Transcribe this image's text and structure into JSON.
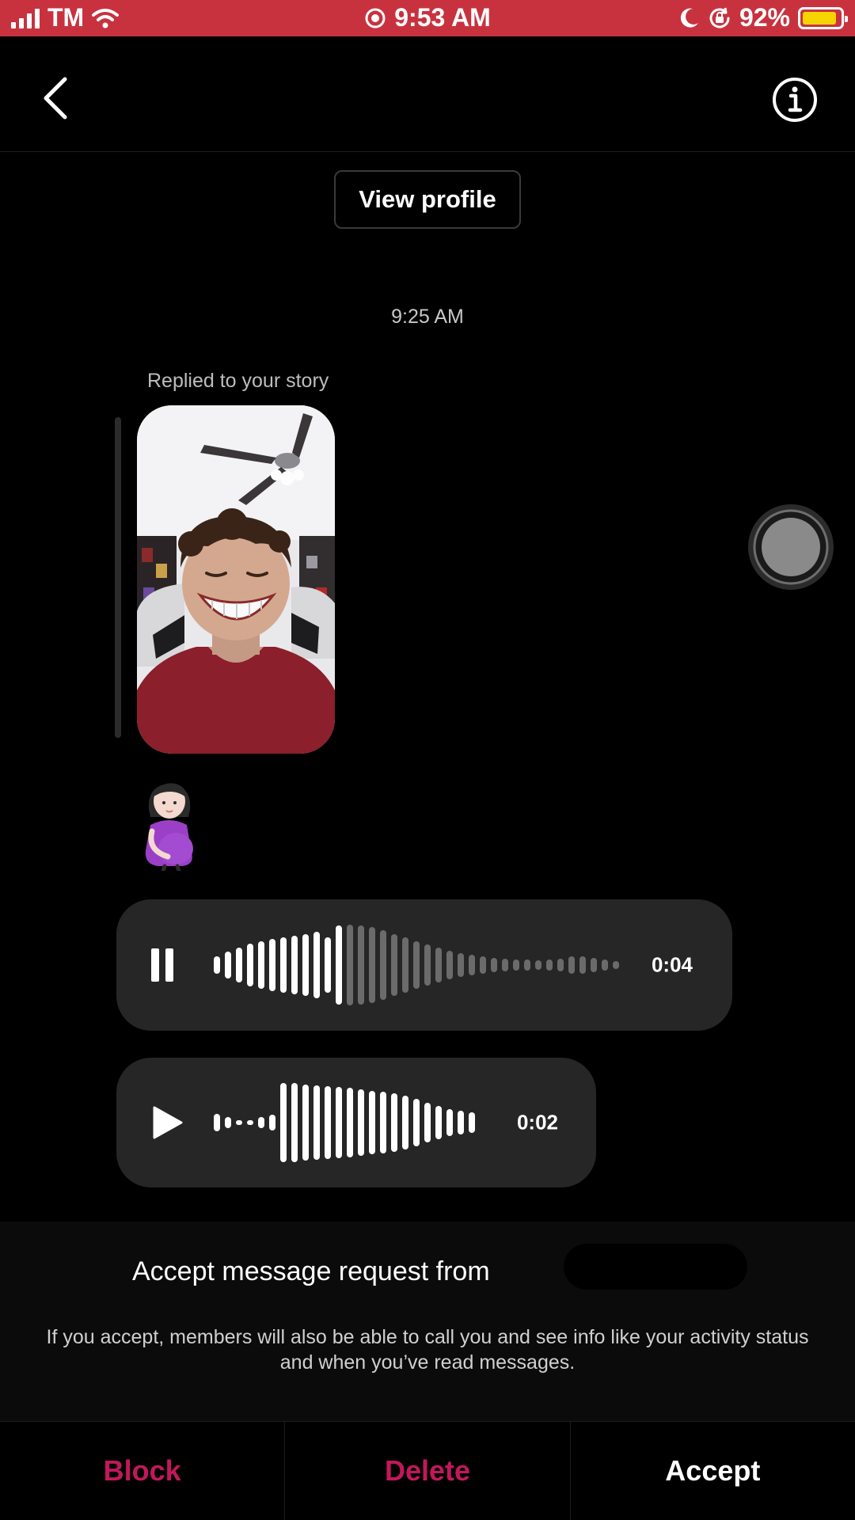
{
  "status_bar": {
    "carrier": "TM",
    "time": "9:53 AM",
    "battery_percent": "92%",
    "battery_level": 0.92,
    "background_color": "#c8323f",
    "icons": [
      "signal-bars-icon",
      "wifi-icon",
      "location-icon",
      "moon-icon",
      "orientation-lock-icon",
      "battery-icon"
    ]
  },
  "header": {
    "back_icon": "chevron-left-icon",
    "info_icon": "info-circle-icon"
  },
  "conversation": {
    "view_profile_label": "View profile",
    "timestamp": "9:25 AM",
    "story_reply_label": "Replied to your story",
    "story_reply_emoji": "🤰🏻",
    "voice_messages": [
      {
        "duration": "0:04",
        "state": "playing",
        "control_icon": "pause-icon",
        "progress": 0.33
      },
      {
        "duration": "0:02",
        "state": "paused",
        "control_icon": "play-icon",
        "progress": 1.0
      }
    ]
  },
  "request": {
    "title": "Accept message request from",
    "body": "If you accept, members will also be able to call you and see info like your activity status and when you’ve read messages."
  },
  "actions": {
    "block_label": "Block",
    "delete_label": "Delete",
    "accept_label": "Accept",
    "block_color": "#c2185b",
    "delete_color": "#c2185b",
    "accept_color": "#ffffff"
  }
}
